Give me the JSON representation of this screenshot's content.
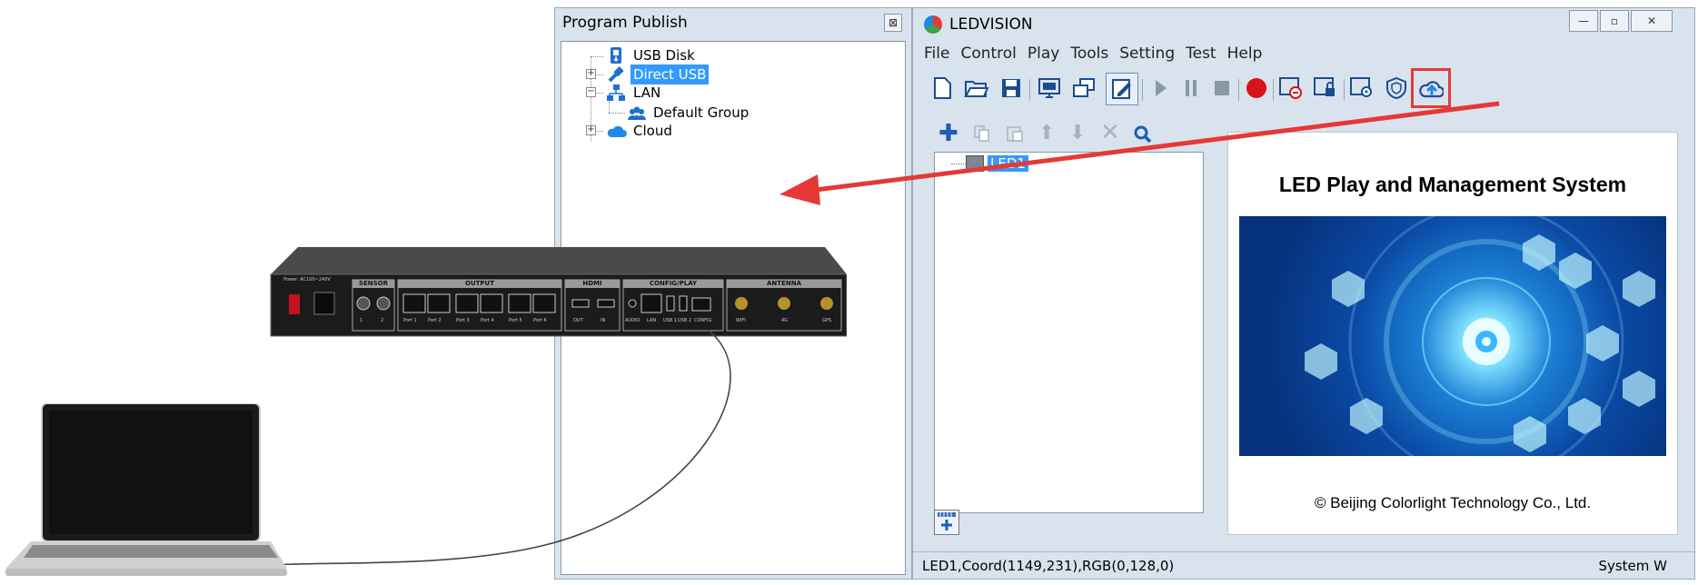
{
  "program_publish": {
    "title": "Program Publish",
    "close_glyph": "⊠",
    "tree": [
      {
        "label": "USB Disk",
        "icon": "usb-icon"
      },
      {
        "label": "Direct USB",
        "icon": "usb-cable-icon",
        "selected": true
      },
      {
        "label": "LAN",
        "icon": "network-icon"
      },
      {
        "label": "Default Group",
        "icon": "group-icon"
      },
      {
        "label": "Cloud",
        "icon": "cloud-icon"
      }
    ]
  },
  "ledvision": {
    "title": "LEDVISION",
    "window_buttons": {
      "minimize": "—",
      "restore": "▫",
      "close": "✕"
    },
    "menu": [
      "File",
      "Control",
      "Play",
      "Tools",
      "Setting",
      "Test",
      "Help"
    ],
    "toolbar_icons": [
      "new-file-icon",
      "open-folder-icon",
      "save-icon",
      "screen-icon",
      "window-icon",
      "edit-icon",
      "play-icon",
      "pause-icon",
      "stop-icon",
      "record-icon",
      "screen-minus-icon",
      "screen-lock-icon",
      "screen-settings-icon",
      "shield-icon",
      "cloud-upload-icon"
    ],
    "tree_tools": [
      "add-icon",
      "copy-icon",
      "paste-icon",
      "move-up-icon",
      "move-down-icon",
      "delete-icon",
      "search-icon"
    ],
    "screen_tree_item": "LED1",
    "splash": {
      "title": "LED Play and Management System",
      "copyright": "© Beijing Colorlight Technology Co., Ltd."
    },
    "status": {
      "info": "LED1,Coord(1149,231),RGB(0,128,0)",
      "right": "System W"
    }
  },
  "device": {
    "power_text": "Power: AC100~240V",
    "sections": [
      "SENSOR",
      "OUTPUT",
      "HDMI",
      "CONFIG/PLAY",
      "ANTENNA"
    ],
    "sensor_ports": [
      "1",
      "2"
    ],
    "output_ports": [
      "Port 1",
      "Port 2",
      "Port 3",
      "Port 4",
      "Port 5",
      "Port 6"
    ],
    "hdmi_ports": [
      "OUT",
      "IN"
    ],
    "config_ports": [
      "AUDIO",
      "LAN",
      "USB 1",
      "USB 2",
      "CONFIG"
    ],
    "antenna_ports": [
      "WIFI",
      "4G",
      "GPS"
    ]
  },
  "colors": {
    "window_bg": "#d9e3ee",
    "selection": "#3399ff",
    "highlight_box": "#e53935",
    "arrow": "#e53935",
    "device_body": "#1b1b1b"
  }
}
